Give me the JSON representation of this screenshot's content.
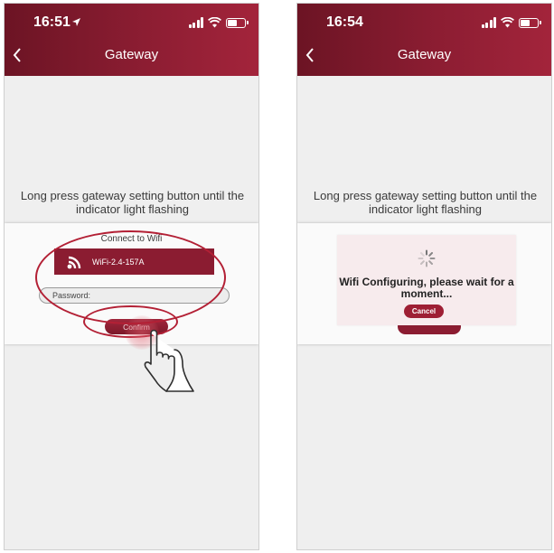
{
  "left_screen": {
    "status": {
      "time": "16:51"
    },
    "nav": {
      "title": "Gateway"
    },
    "instruction": "Long press gateway setting button until the indicator light flashing",
    "wifi_sheet": {
      "title": "Connect to Wifi",
      "wifi_name": "WiFi-2.4-157A",
      "password_placeholder": "Password:",
      "confirm_label": "Confirm"
    }
  },
  "right_screen": {
    "status": {
      "time": "16:54"
    },
    "nav": {
      "title": "Gateway"
    },
    "instruction": "Long press gateway setting button until the indicator light flashing",
    "dialog": {
      "message": "Wifi Configuring, please wait for a moment...",
      "cancel_label": "Cancel"
    }
  },
  "colors": {
    "brand": "#8b1c31",
    "highlight": "#b32035",
    "background": "#efefef"
  },
  "icons": {
    "wifi": "wifi-icon",
    "back": "chevron-left-icon",
    "spinner": "loading-spinner-icon",
    "hand": "hand-pointer-icon"
  }
}
